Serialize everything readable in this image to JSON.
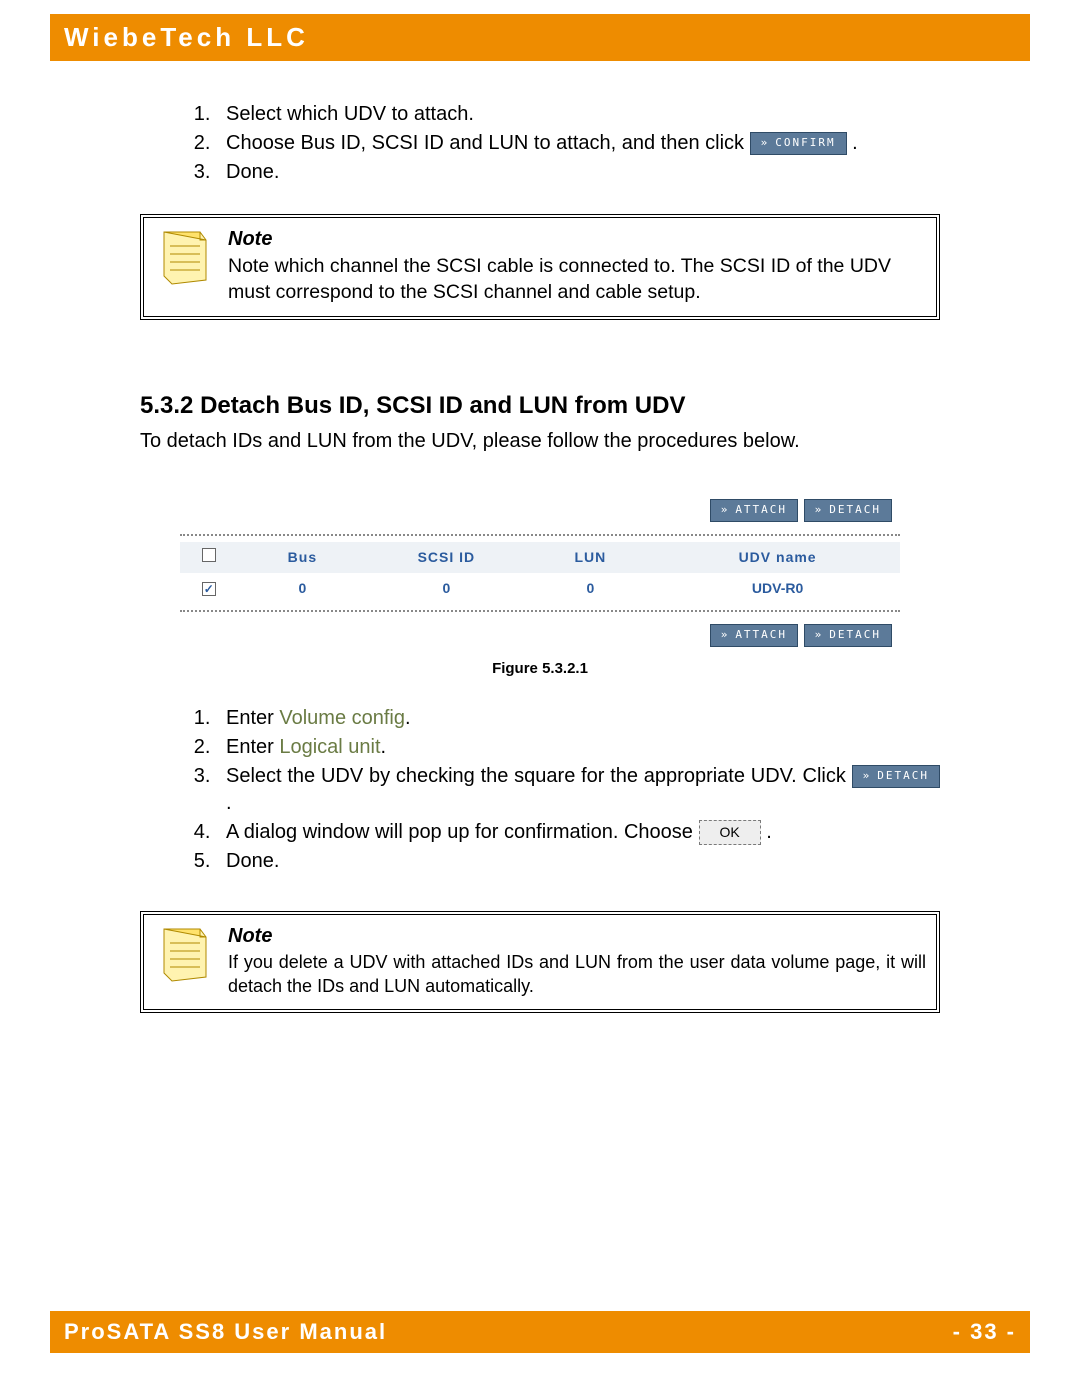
{
  "header": {
    "title": "WiebeTech LLC"
  },
  "steps_a": {
    "items": [
      "Select which UDV to attach.",
      "Choose Bus ID, SCSI ID and LUN to attach, and then click",
      "Done."
    ],
    "confirm_btn": "CONFIRM"
  },
  "note1": {
    "title": "Note",
    "text": "Note which channel the SCSI cable is connected to. The SCSI ID of the UDV must correspond to the SCSI channel and cable setup."
  },
  "section": {
    "number": "5.3.2",
    "title": "Detach Bus ID, SCSI ID and LUN from UDV",
    "para": "To detach IDs and LUN from the UDV, please follow the procedures below."
  },
  "figure": {
    "buttons": {
      "attach": "ATTACH",
      "detach": "DETACH"
    },
    "headers": [
      "",
      "Bus",
      "SCSI ID",
      "LUN",
      "UDV name"
    ],
    "row": {
      "checked": true,
      "bus": "0",
      "scsi": "0",
      "lun": "0",
      "udv": "UDV-R0"
    },
    "caption": "Figure 5.3.2.1"
  },
  "steps_b": {
    "enter": "Enter ",
    "link1": "Volume config",
    "link2": "Logical unit",
    "step3a": "Select the UDV by checking the square for the appropriate UDV. Click",
    "detach_btn": "DETACH",
    "step4a": "A dialog window will pop up for confirmation. Choose",
    "ok_btn": "OK",
    "step5": "Done."
  },
  "note2": {
    "title": "Note",
    "text": "If you delete a UDV with attached IDs and LUN from the user data volume page, it will detach the IDs and LUN automatically."
  },
  "footer": {
    "left": "ProSATA SS8 User Manual",
    "right": "- 33 -"
  }
}
